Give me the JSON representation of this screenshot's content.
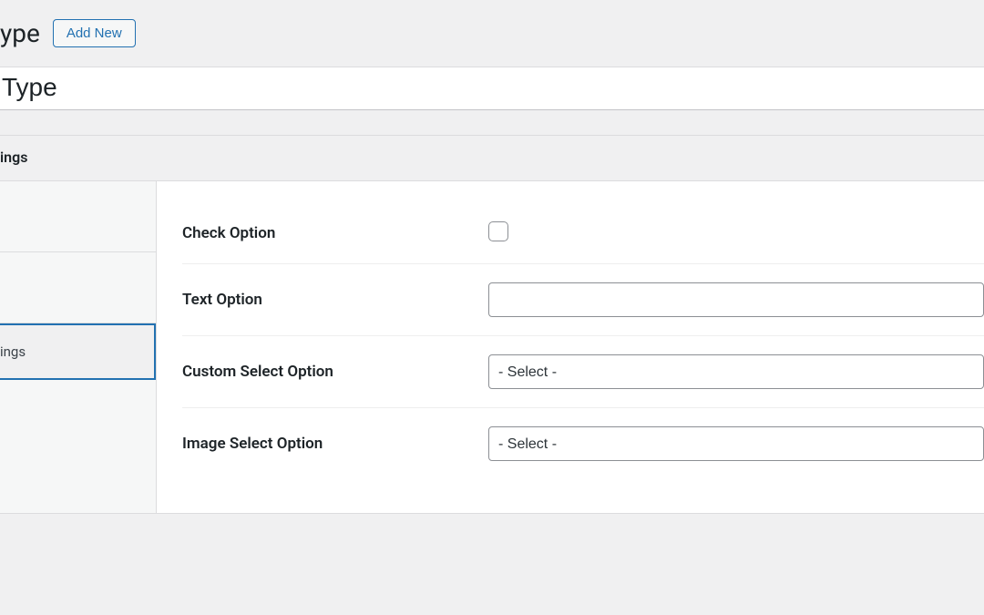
{
  "header": {
    "page_type_suffix": "ype",
    "add_new_label": "Add New"
  },
  "title_input": {
    "value": "Type"
  },
  "panel": {
    "heading_suffix": "ings"
  },
  "tabs": {
    "active_label_suffix": "ings"
  },
  "fields": {
    "check": {
      "label": "Check Option",
      "checked": false
    },
    "text": {
      "label": "Text Option",
      "value": ""
    },
    "custom_select": {
      "label": "Custom Select Option",
      "selected": "- Select -"
    },
    "image_select": {
      "label": "Image Select Option",
      "selected": "- Select -"
    }
  }
}
